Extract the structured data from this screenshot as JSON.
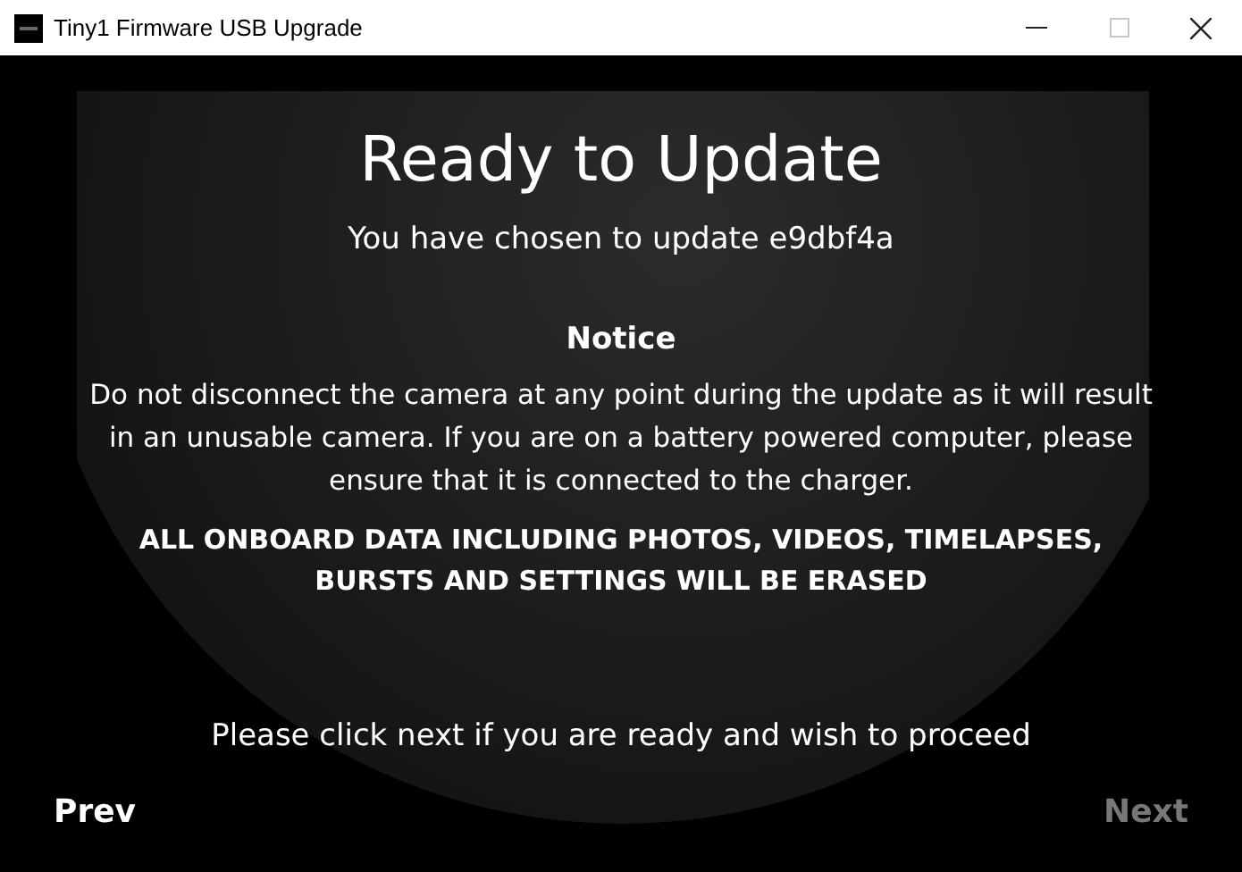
{
  "window": {
    "title": "Tiny1 Firmware USB Upgrade",
    "controls": [
      {
        "kind": "minimize",
        "disabled": false
      },
      {
        "kind": "maximize",
        "disabled": true
      },
      {
        "kind": "close",
        "disabled": false
      }
    ]
  },
  "heading": "Ready to Update",
  "subtitle": "You have chosen to update e9dbf4a",
  "notice": {
    "title": "Notice",
    "body": "Do not disconnect the camera at any point during the update as it will result in an unusable camera. If you are on a battery powered computer, please ensure that it is connected to the charger.",
    "warning": "ALL ONBOARD DATA INCLUDING PHOTOS, VIDEOS, TIMELAPSES, BURSTS AND SETTINGS WILL BE ERASED"
  },
  "prompt": "Please click next if you are ready and wish to proceed",
  "buttons": [
    {
      "label": "Prev",
      "disabled": false
    },
    {
      "label": "Next",
      "disabled": true
    }
  ]
}
